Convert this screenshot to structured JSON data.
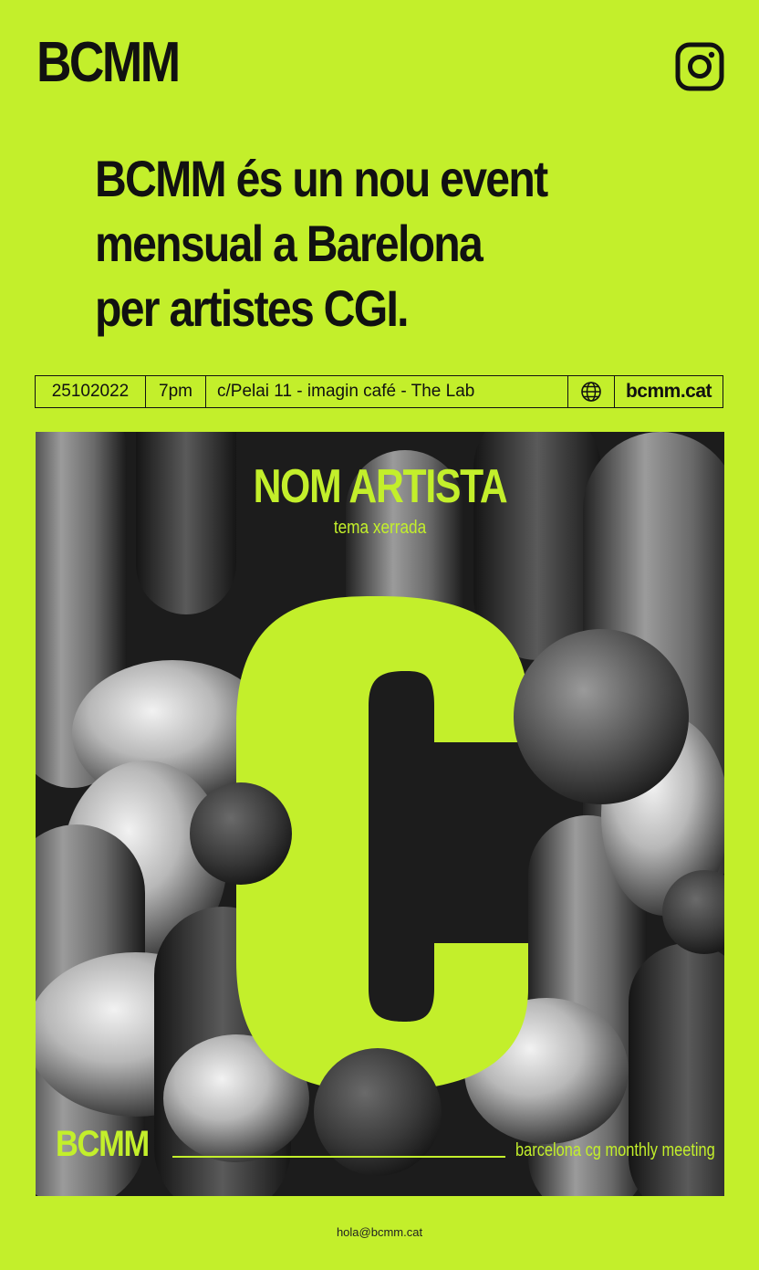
{
  "brand": "BCMM",
  "headline": [
    "BCMM és un nou event",
    "mensual a Barelona",
    "per artistes CGI."
  ],
  "info": {
    "date": "25102022",
    "time": "7pm",
    "address": "c/Pelai 11 - imagin café - The Lab",
    "website": "bcmm.cat",
    "globe_icon": "globe-icon"
  },
  "poster": {
    "artist_name": "NOM ARTISTA",
    "talk_theme": "tema xerrada",
    "logo": "BCMM",
    "tagline": "barcelona cg monthly meeting",
    "big_letter": "C"
  },
  "footer": {
    "email": "hola@bcmm.cat"
  },
  "colors": {
    "accent": "#c3ef2b",
    "ink": "#111111",
    "poster_bg": "#1c1c1c"
  }
}
